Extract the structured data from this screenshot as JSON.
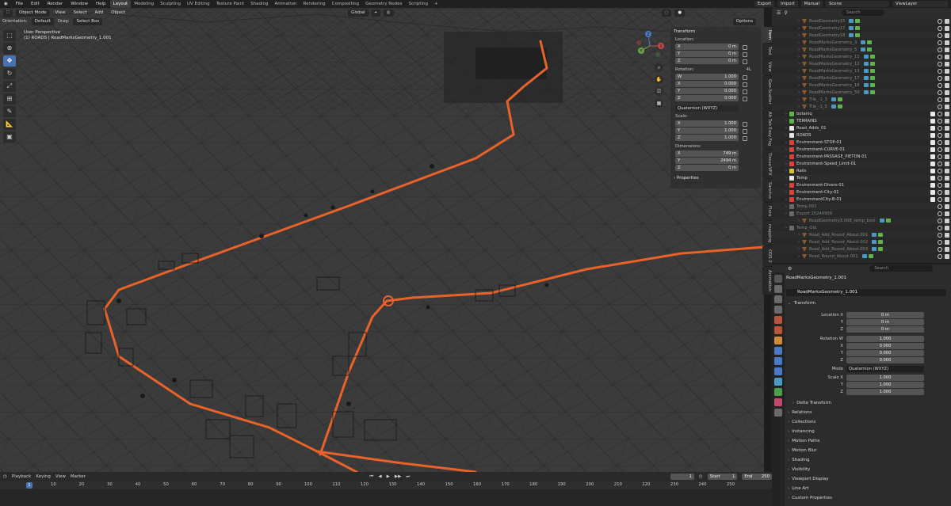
{
  "topbar": {
    "menus": [
      "File",
      "Edit",
      "Render",
      "Window",
      "Help"
    ],
    "workspaces": [
      "Layout",
      "Modeling",
      "Sculpting",
      "UV Editing",
      "Texture Paint",
      "Shading",
      "Animation",
      "Rendering",
      "Compositing",
      "Geometry Nodes",
      "Scripting"
    ],
    "active_workspace": "Layout",
    "add_tab": "+",
    "export": "Export",
    "import": "Import",
    "manual": "Manual",
    "scene": "Scene",
    "view_layer": "ViewLayer"
  },
  "viewport": {
    "mode": "Object Mode",
    "menus": [
      "View",
      "Select",
      "Add",
      "Object"
    ],
    "transform_space": "Global",
    "options": "Options",
    "orientation_label": "Orientation:",
    "orientation": "Default",
    "drag_label": "Drag:",
    "drag": "Select Box",
    "perspective": "User Perspective",
    "active_object": "(1) ROADS | RoadMarksGeometry_1.001",
    "gizmo": {
      "x": "X",
      "y": "Y",
      "z": "Z"
    }
  },
  "npanel": {
    "title": "Transform",
    "location_label": "Location:",
    "location": [
      {
        "k": "X",
        "v": "0 m"
      },
      {
        "k": "Y",
        "v": "0 m"
      },
      {
        "k": "Z",
        "v": "0 m"
      }
    ],
    "rotation_label": "Rotation:",
    "rotation_lock": "4L",
    "rotation": [
      {
        "k": "W",
        "v": "1.000"
      },
      {
        "k": "X",
        "v": "0.000"
      },
      {
        "k": "Y",
        "v": "0.000"
      },
      {
        "k": "Z",
        "v": "0.000"
      }
    ],
    "rotation_mode": "Quaternion (WXYZ)",
    "scale_label": "Scale:",
    "scale": [
      {
        "k": "X",
        "v": "1.000"
      },
      {
        "k": "Y",
        "v": "1.000"
      },
      {
        "k": "Z",
        "v": "1.000"
      }
    ],
    "dimensions_label": "Dimensions:",
    "dimensions": [
      {
        "k": "X",
        "v": "749 m"
      },
      {
        "k": "Y",
        "v": "2494 m"
      },
      {
        "k": "Z",
        "v": "0 m"
      }
    ],
    "properties": "Properties",
    "tabs": [
      "Item",
      "Tool",
      "View",
      "Geo-Scatter",
      "Alt Tab Easy Fog",
      "Tissue-VFX",
      "Sanctus",
      "Flora",
      "mapping",
      "ODS 2",
      "Animation"
    ]
  },
  "timeline": {
    "menus": [
      "Playback",
      "Keying",
      "View",
      "Marker"
    ],
    "current_frame": "1",
    "start_label": "Start",
    "start": "1",
    "end_label": "End",
    "end": "250",
    "ticks": [
      "10",
      "20",
      "30",
      "40",
      "50",
      "60",
      "70",
      "80",
      "90",
      "100",
      "110",
      "120",
      "130",
      "140",
      "150",
      "160",
      "170",
      "180",
      "190",
      "200",
      "210",
      "220",
      "230",
      "240",
      "250"
    ],
    "playhead": "1"
  },
  "outliner": {
    "search_placeholder": "Search",
    "rows": [
      {
        "name": "RoadGeometry15",
        "kind": "mesh",
        "dim": true
      },
      {
        "name": "RoadGeometry17",
        "kind": "mesh",
        "dim": true
      },
      {
        "name": "RoadGeometry18",
        "kind": "mesh",
        "dim": true
      },
      {
        "name": "RoadMarksGeometry_3",
        "kind": "mesh",
        "dim": true
      },
      {
        "name": "RoadMarksGeometry_5",
        "kind": "mesh",
        "dim": true
      },
      {
        "name": "RoadMarksGeometry_11",
        "kind": "mesh",
        "dim": true
      },
      {
        "name": "RoadMarksGeometry_12",
        "kind": "mesh",
        "dim": true
      },
      {
        "name": "RoadMarksGeometry_13",
        "kind": "mesh",
        "dim": true
      },
      {
        "name": "RoadMarksGeometry_17",
        "kind": "mesh",
        "dim": true
      },
      {
        "name": "RoadMarksGeometry_18",
        "kind": "mesh",
        "dim": true
      },
      {
        "name": "RoadMarksGeometry_50",
        "kind": "mesh",
        "dim": true
      },
      {
        "name": "Tile_-1_3",
        "kind": "mesh",
        "dim": true
      },
      {
        "name": "Tile_-1_5",
        "kind": "mesh",
        "dim": true
      },
      {
        "name": "botaniq",
        "kind": "coll",
        "color": "green"
      },
      {
        "name": "TERRAINS",
        "kind": "coll",
        "color": "green"
      },
      {
        "name": "Road_Adds_01",
        "kind": "coll",
        "color": "white"
      },
      {
        "name": "ROADS",
        "kind": "coll",
        "color": "white"
      },
      {
        "name": "Environment-STOP-01",
        "kind": "coll",
        "color": "red"
      },
      {
        "name": "Environment-CURVE-01",
        "kind": "coll",
        "color": "red"
      },
      {
        "name": "Environment-PASSAGE_PIETON-01",
        "kind": "coll",
        "color": "red"
      },
      {
        "name": "Environment-Speed_Limit-01",
        "kind": "coll",
        "color": "red"
      },
      {
        "name": "Rails",
        "kind": "coll",
        "color": "yellow"
      },
      {
        "name": "Temp",
        "kind": "coll",
        "color": "white"
      },
      {
        "name": "Environment-Divers-01",
        "kind": "coll",
        "color": "red"
      },
      {
        "name": "Environment-City-01",
        "kind": "coll",
        "color": "red"
      },
      {
        "name": "EnvironmentCity-B-01",
        "kind": "coll",
        "color": "red"
      },
      {
        "name": "Temp.001",
        "kind": "coll",
        "color": "gray",
        "dim": true
      },
      {
        "name": "Export 20240909",
        "kind": "coll",
        "color": "gray",
        "dim": true
      },
      {
        "name": "RoadGeometry3.008_temp_bool",
        "kind": "mesh",
        "dim": true
      },
      {
        "name": "Temp_Old",
        "kind": "coll",
        "color": "gray",
        "dim": true
      },
      {
        "name": "Road_Add_Round_About.001",
        "kind": "mesh",
        "dim": true
      },
      {
        "name": "Road_Add_Round_About.002",
        "kind": "mesh",
        "dim": true
      },
      {
        "name": "Road_Add_Round_About.003",
        "kind": "mesh",
        "dim": true
      },
      {
        "name": "Road_Round_About.001",
        "kind": "mesh",
        "dim": true
      }
    ]
  },
  "properties": {
    "search_placeholder": "Search",
    "object_name": "RoadMarksGeometry_1.001",
    "name_field": "RoadMarksGeometry_1.001",
    "transform": "Transform",
    "location_x_label": "Location X",
    "location": [
      "0 m",
      "0 m",
      "0 m"
    ],
    "rotation_w_label": "Rotation W",
    "rotation": [
      "1.000",
      "0.000",
      "0.000",
      "0.000"
    ],
    "mode_label": "Mode",
    "mode": "Quaternion (WXYZ)",
    "scale_x_label": "Scale X",
    "scale": [
      "1.000",
      "1.000",
      "1.000"
    ],
    "axis": {
      "x": "X",
      "y": "Y",
      "z": "Z"
    },
    "sections": [
      "Delta Transform",
      "Relations",
      "Collections",
      "Instancing",
      "Motion Paths",
      "Motion Blur",
      "Shading",
      "Visibility",
      "Viewport Display",
      "Line Art",
      "Custom Properties"
    ]
  },
  "colors": {
    "road": "#e8622a",
    "viewport_bg": "#3b3b3b",
    "accent": "#4772b3"
  }
}
